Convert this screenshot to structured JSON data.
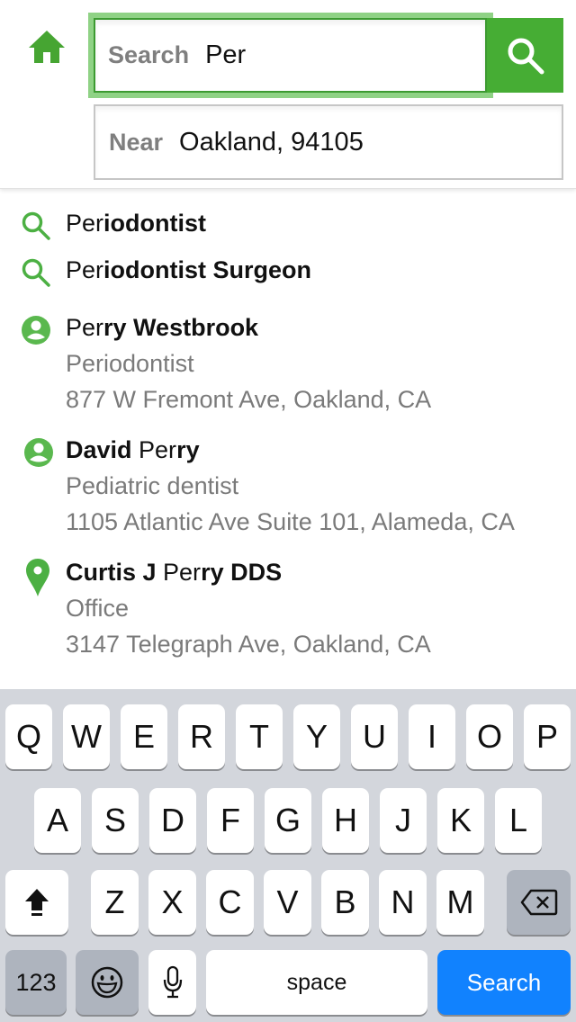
{
  "colors": {
    "brand_green": "#46ad34",
    "search_key_blue": "#1182fe",
    "keyboard_bg": "#d3d6dc"
  },
  "header": {
    "home_icon": "home-icon",
    "search": {
      "label": "Search",
      "value": "Per"
    },
    "near": {
      "label": "Near",
      "value": "Oakland, 94105"
    },
    "search_button_icon": "search-icon"
  },
  "suggestions": [
    {
      "type": "search",
      "icon": "search-icon",
      "title_parts": [
        {
          "text": "Per",
          "bold": false
        },
        {
          "text": "iodontist",
          "bold": true
        }
      ]
    },
    {
      "type": "search",
      "icon": "search-icon",
      "title_parts": [
        {
          "text": "Per",
          "bold": false
        },
        {
          "text": "iodontist Surgeon",
          "bold": true
        }
      ]
    },
    {
      "type": "person",
      "icon": "person-icon",
      "title_parts": [
        {
          "text": "Per",
          "bold": false
        },
        {
          "text": "ry Westbrook",
          "bold": true
        }
      ],
      "specialty": "Periodontist",
      "address": "877 W Fremont Ave, Oakland, CA"
    },
    {
      "type": "person",
      "icon": "person-icon",
      "title_parts": [
        {
          "text": "David ",
          "bold": true
        },
        {
          "text": "Per",
          "bold": false
        },
        {
          "text": "ry",
          "bold": true
        }
      ],
      "specialty": "Pediatric dentist",
      "address": "1105 Atlantic Ave Suite 101, Alameda, CA"
    },
    {
      "type": "place",
      "icon": "map-pin-icon",
      "title_parts": [
        {
          "text": "Curtis J ",
          "bold": true
        },
        {
          "text": "Per",
          "bold": false
        },
        {
          "text": "ry DDS",
          "bold": true
        }
      ],
      "specialty": "Office",
      "address": "3147 Telegraph Ave, Oakland, CA"
    }
  ],
  "keyboard": {
    "row1": [
      "Q",
      "W",
      "E",
      "R",
      "T",
      "Y",
      "U",
      "I",
      "O",
      "P"
    ],
    "row2": [
      "A",
      "S",
      "D",
      "F",
      "G",
      "H",
      "J",
      "K",
      "L"
    ],
    "row3": [
      "Z",
      "X",
      "C",
      "V",
      "B",
      "N",
      "M"
    ],
    "shift_icon": "shift-icon",
    "delete_icon": "backspace-icon",
    "numbers_label": "123",
    "emoji_icon": "emoji-icon",
    "mic_icon": "microphone-icon",
    "space_label": "space",
    "return_label": "Search"
  }
}
